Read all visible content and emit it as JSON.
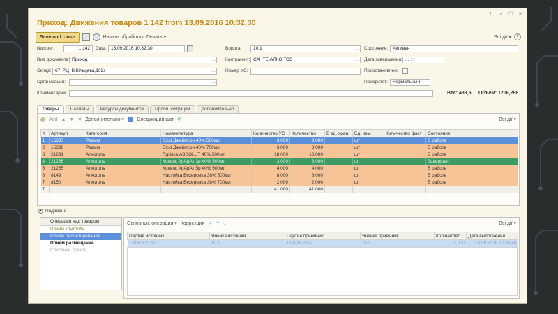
{
  "window": {
    "title": "Приход: Движения товаров 1 142 from 13.09.2016 10:32:30",
    "controls": [
      "⋮",
      "↗",
      "☐",
      "✕"
    ]
  },
  "toolbar": {
    "save_close": "Save and close",
    "start_processing": "Начать обработку",
    "print": "Печать ▾",
    "all_actions": "Всі дії ▾",
    "help": "?"
  },
  "form": {
    "number_label": "Number:",
    "number_value": "1 142",
    "date_label": "Date:",
    "date_value": "13.09.2016 10:32:30",
    "gate_label": "Ворота:",
    "gate_value": "10.1",
    "state_label": "Состояние:",
    "state_value": "Активен",
    "doc_type_label": "Вид документа:",
    "doc_type_value": "Приход",
    "contractor_label": "Контрагент:",
    "contractor_value": "САНТЕ-АЛКО ТОВ",
    "end_date_label": "Дата завершения:",
    "end_date_value": ". .   : :",
    "warehouse_label": "Склад:",
    "warehouse_value": "67_РЦ_В.Кільцева,102з",
    "us_number_label": "Номер УС:",
    "us_number_value": "",
    "suspended_label": "Приостановлен:",
    "org_label": "Организация:",
    "org_value": "",
    "priority_label": "Приоритет:",
    "priority_value": "Нормальный",
    "comment_label": "Комментарий:",
    "comment_value": "",
    "weight": "Вес: 433,5",
    "volume": "Объем: 1206,288"
  },
  "tabs": [
    "Товары",
    "Паллеты",
    "Ресурсы документов",
    "Пробл. ситуации",
    "Дополнительно"
  ],
  "grid_toolbar": {
    "add": "Add",
    "additional": "Дополнительно ▾",
    "next_step": "Следующий шаг",
    "all_actions": "Всі дії ▾"
  },
  "grid": {
    "columns": [
      "#",
      "Артикул",
      "Категория",
      "Номенклатура",
      "Количество УС",
      "Количество",
      "В ед. хран.",
      "Ед. изм.",
      "Количество факт",
      "Состояние"
    ],
    "rows": [
      {
        "n": "1",
        "art": "15337",
        "cat": "Режим",
        "nom": "Віскі Джеймсон 40% 500мл",
        "qus": "3,000",
        "qty": "3,000",
        "unit_store": "",
        "unit": "шт",
        "fact": "",
        "state": "В работе",
        "style": "row-blue"
      },
      {
        "n": "2",
        "art": "15336",
        "cat": "Режим",
        "nom": "Віскі Джеймсон 40% 700мл",
        "qus": "3,000",
        "qty": "3,000",
        "unit_store": "",
        "unit": "шт",
        "fact": "",
        "state": "В работе",
        "style": "row-orange"
      },
      {
        "n": "3",
        "art": "21291",
        "cat": "Алкоголь",
        "nom": "Горілка ABSOLUT 40% 500мл",
        "qus": "18,000",
        "qty": "18,000",
        "unit_store": "",
        "unit": "шт",
        "fact": "",
        "state": "В работе",
        "style": "row-orange"
      },
      {
        "n": "4",
        "art": "21286",
        "cat": "Алкоголь",
        "nom": "Коньяк АрАрАт 3р 40% 500мл",
        "qus": "3,000",
        "qty": "3,000",
        "unit_store": "",
        "unit": "шт",
        "fact": "",
        "state": "Завершен",
        "style": "row-green"
      },
      {
        "n": "5",
        "art": "21285",
        "cat": "Алкоголь",
        "nom": "Коньяк АрАрАт 5р 40% 500мл",
        "qus": "4,000",
        "qty": "4,000",
        "unit_store": "",
        "unit": "шт",
        "fact": "",
        "state": "В работе",
        "style": "row-orange"
      },
      {
        "n": "6",
        "art": "8149",
        "cat": "Алкоголь",
        "nom": "Настойка Бехеровка 38% 500мл",
        "qus": "8,000",
        "qty": "8,000",
        "unit_store": "",
        "unit": "шт",
        "fact": "",
        "state": "В работе",
        "style": "row-orange"
      },
      {
        "n": "7",
        "art": "8150",
        "cat": "Алкоголь",
        "nom": "Настойка Бехеровка 38% 700мл",
        "qus": "2,000",
        "qty": "2,000",
        "unit_store": "",
        "unit": "шт",
        "fact": "",
        "state": "В работе",
        "style": "row-orange"
      }
    ],
    "total": {
      "n": "7",
      "qus": "41,000",
      "qty": "41,000"
    }
  },
  "details_label": "Подробно",
  "operations": {
    "header": "Операция над товаром",
    "items": [
      "Прием контроль",
      "Прием паллетирование",
      "Прием размещение",
      "Списание товара"
    ]
  },
  "sub_toolbar": {
    "main_ops": "Основные операции ▾",
    "correction": "Коррекция",
    "all_actions": "Всі дії ▾"
  },
  "sub_grid": {
    "columns": [
      "Партия источник",
      "Ячейка источник",
      "Партия приемник",
      "Ячейка приемник",
      "Количество",
      "Дата выполнения"
    ],
    "row": [
      "130916.2192",
      "10.1",
      "130916.2192",
      "10.1",
      "3,000",
      "13.09.2016 10:38:46"
    ]
  }
}
